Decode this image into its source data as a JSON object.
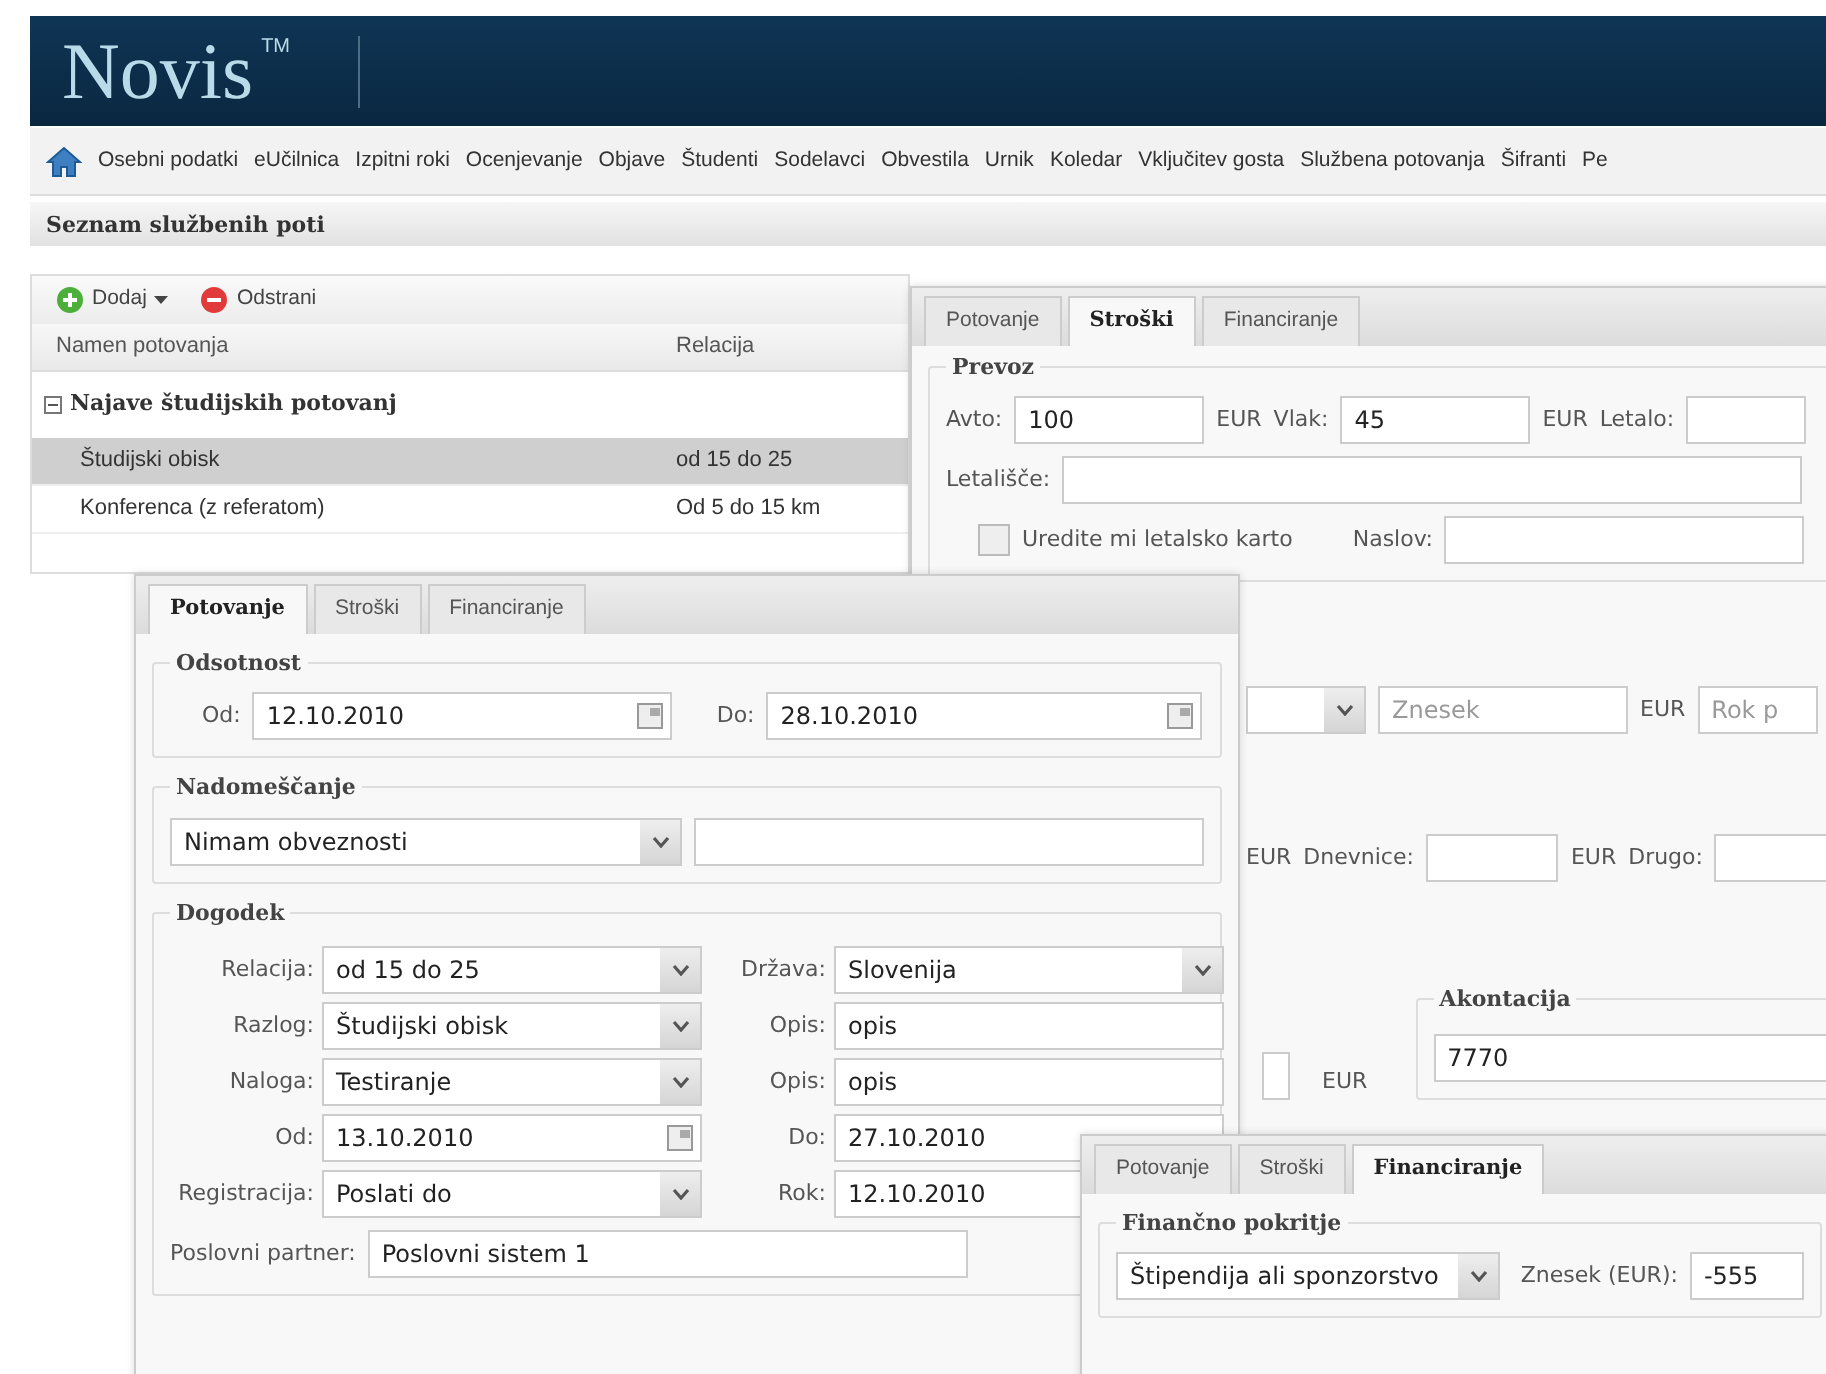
{
  "header": {
    "logo": "Novis",
    "trademark": "TM"
  },
  "nav": {
    "items": [
      "Osebni podatki",
      "eUčilnica",
      "Izpitni roki",
      "Ocenjevanje",
      "Objave",
      "Študenti",
      "Sodelavci",
      "Obvestila",
      "Urnik",
      "Koledar",
      "Vključitev gosta",
      "Službena potovanja",
      "Šifranti",
      "Pe"
    ]
  },
  "list_panel": {
    "title": "Seznam službenih poti",
    "toolbar": [
      {
        "label": "Dodaj",
        "kind": "add",
        "menu": true
      },
      {
        "label": "Odstrani",
        "kind": "remove",
        "menu": false
      }
    ],
    "columns": [
      "Namen potovanja",
      "Relacija"
    ],
    "group": {
      "label": "Najave študijskih potovanj",
      "expanded": true,
      "rows": [
        {
          "name": "Študijski obisk",
          "relacija": "od 15 do 25",
          "selected": true
        },
        {
          "name": "Konferenca (z referatom)",
          "relacija": "Od 5 do 15 km",
          "selected": false
        }
      ]
    }
  },
  "costs_panel": {
    "tabs": [
      {
        "label": "Potovanje",
        "selected": false
      },
      {
        "label": "Stroški",
        "selected": true
      },
      {
        "label": "Financiranje",
        "selected": false
      }
    ],
    "prevoz": {
      "legend": "Prevoz",
      "lines": [
        {
          "fields": [
            {
              "kind": "text",
              "label": "Avto:",
              "value": "100",
              "unit": "EUR"
            },
            {
              "kind": "text",
              "label": "Vlak:",
              "value": "45",
              "unit": "EUR"
            },
            {
              "kind": "text",
              "label": "Letalo:"
            }
          ]
        },
        {
          "fields": [
            {
              "kind": "text",
              "label": "Letališče:"
            }
          ]
        },
        {
          "fields": [
            {
              "kind": "checkbox",
              "label": "Uredite mi letalsko karto",
              "checked": false
            },
            {
              "kind": "text",
              "label": "Naslov:"
            }
          ]
        }
      ]
    },
    "lines": [
      {
        "fields": [
          {
            "kind": "select"
          },
          {
            "kind": "text",
            "placeholder": "Znesek",
            "unit": "EUR"
          },
          {
            "kind": "text",
            "placeholder": "Rok p"
          }
        ]
      },
      {
        "fields": [
          {
            "kind": "unit",
            "label": "EUR"
          },
          {
            "kind": "text",
            "label": "Dnevnice:",
            "unit": "EUR"
          },
          {
            "kind": "text",
            "label": "Drugo:"
          }
        ]
      }
    ],
    "amount": {
      "unit": "EUR"
    },
    "advance": {
      "legend": "Akontacija",
      "value": "7770"
    }
  },
  "trip_panel": {
    "tabs": [
      {
        "label": "Potovanje",
        "selected": true
      },
      {
        "label": "Stroški",
        "selected": false
      },
      {
        "label": "Financiranje",
        "selected": false
      }
    ],
    "sections": [
      {
        "legend": "Odsotnost",
        "kind": "dates",
        "fields": [
          {
            "kind": "date",
            "label": "Od:",
            "value": "12.10.2010"
          },
          {
            "kind": "date",
            "label": "Do:",
            "value": "28.10.2010"
          }
        ]
      },
      {
        "legend": "Nadomeščanje",
        "kind": "substitute",
        "fields": [
          {
            "kind": "select",
            "value": "Nimam obveznosti"
          },
          {
            "kind": "text"
          }
        ]
      },
      {
        "legend": "Dogodek",
        "kind": "grid",
        "fields": [
          {
            "kind": "select",
            "label": "Relacija:",
            "value": "od 15 do 25"
          },
          {
            "kind": "select",
            "label": "Država:",
            "value": "Slovenija"
          },
          {
            "kind": "select",
            "label": "Razlog:",
            "value": "Študijski obisk"
          },
          {
            "kind": "text",
            "label": "Opis:",
            "value": "opis"
          },
          {
            "kind": "select",
            "label": "Naloga:",
            "value": "Testiranje"
          },
          {
            "kind": "text",
            "label": "Opis:",
            "value": "opis"
          },
          {
            "kind": "date",
            "label": "Od:",
            "value": "13.10.2010"
          },
          {
            "kind": "text",
            "label": "Do:",
            "value": "27.10.2010"
          },
          {
            "kind": "select",
            "label": "Registracija:",
            "value": "Poslati do"
          },
          {
            "kind": "text",
            "label": "Rok:",
            "value": "12.10.2010"
          }
        ],
        "partner": {
          "label": "Poslovni partner:",
          "value": "Poslovni sistem 1"
        }
      }
    ]
  },
  "finance_panel": {
    "tabs": [
      {
        "label": "Potovanje",
        "selected": false
      },
      {
        "label": "Stroški",
        "selected": false
      },
      {
        "label": "Financiranje",
        "selected": true
      }
    ],
    "legend": "Finančno pokritje",
    "source": {
      "value": "Štipendija ali sponzorstvo"
    },
    "amount": {
      "label": "Znesek (EUR):",
      "value": "-555"
    }
  }
}
